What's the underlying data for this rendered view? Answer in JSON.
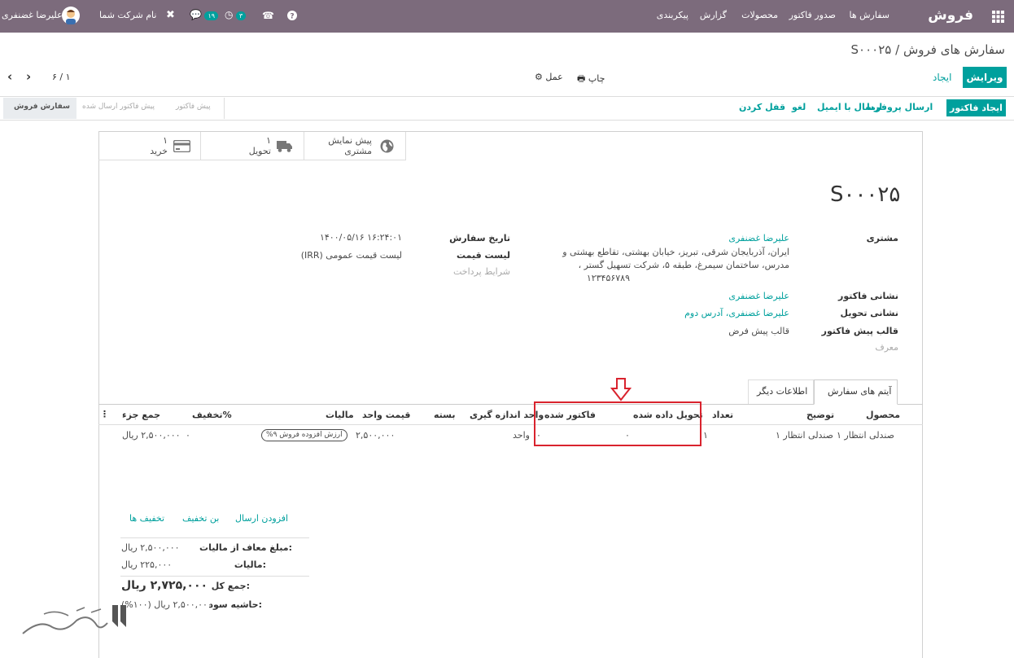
{
  "topbar": {
    "app_name": "فروش",
    "menu": [
      "سفارش ها",
      "صدور فاکتور",
      "محصولات",
      "گزارش",
      "پیکربندی"
    ],
    "user_name": "علیرضا غضنفری",
    "company": "نام شرکت شما",
    "activity_count": "۳",
    "message_count": "۱۹"
  },
  "breadcrumb": {
    "parent": "سفارش های فروش",
    "separator": "/",
    "current": "S۰۰۰۲۵"
  },
  "controls": {
    "edit": "ویرایش",
    "create": "ایجاد",
    "print": "چاپ",
    "action": "عمل",
    "pager": "۶ / ۱"
  },
  "statusbar": {
    "actions": [
      "ایجاد فاکتور",
      "ارسال پروفرما",
      "ارسال با ایمیل",
      "لغو",
      "قفل کردن"
    ],
    "stages": [
      "سفارش فروش",
      "پیش فاکتور ارسال شده",
      "پیش فاکتور"
    ]
  },
  "smart_buttons": [
    {
      "line1": "پیش نمایش",
      "line2": "مشتری",
      "icon": "globe-icon"
    },
    {
      "line1": "۱",
      "line2": "تحویل",
      "icon": "truck-icon"
    },
    {
      "line1": "۱",
      "line2": "خرید",
      "icon": "credit-card-icon"
    }
  ],
  "order": {
    "name": "S۰۰۰۲۵",
    "customer_label": "مشتری",
    "customer_name": "علیرضا غضنفری",
    "address1": "ایران، آذربایجان شرقی، تبریز، خیابان بهشتی، تقاطع بهشتی و",
    "address2": "مدرس، ساختمان سیمرغ، طبقه ۵، شرکت تسهیل گستر ،",
    "address3": "۱۲۳۴۵۶۷۸۹",
    "invoice_address_label": "نشانی فاکتور",
    "invoice_address": "علیرضا غضنفری",
    "delivery_address_label": "نشانی تحویل",
    "delivery_address": "علیرضا غضنفری، آدرس دوم",
    "template_label": "قالب پیش فاکتور",
    "template": "قالب پیش فرض",
    "referrer_label": "معرف",
    "date_label": "تاریخ سفارش",
    "date": "۱۴۰۰/۰۵/۱۶ ۱۶:۲۴:۰۱",
    "pricelist_label": "لیست قیمت",
    "pricelist": "لیست قیمت عمومی (IRR)",
    "payment_terms_label": "شرایط پرداخت"
  },
  "tabs": [
    "آیتم های سفارش",
    "اطلاعات دیگر"
  ],
  "table": {
    "headers": {
      "product": "محصول",
      "description": "توضیح",
      "qty": "تعداد",
      "delivered": "تحویل داده شده",
      "invoiced": "فاکتور شده",
      "uom": "واحد اندازه گیری",
      "package": "بسته",
      "unit_price": "قیمت واحد",
      "taxes": "مالیات",
      "discount": "تخفیف%",
      "subtotal": "جمع جزء"
    },
    "row": {
      "product": "صندلی انتظار ۱",
      "description": "صندلی انتظار ۱",
      "qty": "۱",
      "delivered": "۰",
      "invoiced": "۰",
      "uom": "واحد",
      "unit_price": "۲,۵۰۰,۰۰۰",
      "taxes": "ارزش افزوده فروش ۹%",
      "discount": "۰",
      "subtotal": "۲,۵۰۰,۰۰۰ ریال"
    }
  },
  "links": [
    "افزودن ارسال",
    "بن تخفیف",
    "تخفیف ها"
  ],
  "totals": {
    "untaxed_label": "مبلغ معاف از مالیات:",
    "untaxed": "۲,۵۰۰,۰۰۰ ریال",
    "tax_label": "مالیات:",
    "tax": "۲۲۵,۰۰۰ ریال",
    "total_label": "جمع کل:",
    "total": "۲,۷۲۵,۰۰۰ ریال",
    "margin_label": "حاشیه سود:",
    "margin": "۲,۵۰۰,۰۰۰ ریال (۱۰۰%)"
  },
  "colors": {
    "topbar": "#7c6b7c",
    "accent": "#00a09d",
    "highlight": "#d9232e"
  }
}
